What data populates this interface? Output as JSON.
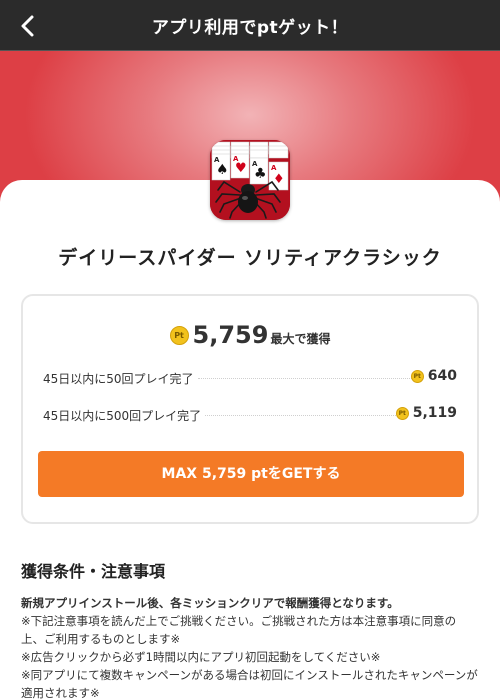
{
  "header": {
    "title": "アプリ利用でptゲット！",
    "back_icon": "chevron-left-icon"
  },
  "colors": {
    "header_bg": "#2b2b2b",
    "hero_red": "#dd3f45",
    "accent_orange": "#f47a26",
    "coin_gold": "#f2c21d"
  },
  "app": {
    "name": "デイリースパイダー ソリティアクラシック",
    "icon": "spider-solitaire-app-icon"
  },
  "reward": {
    "coin_text": "Pt",
    "total_value": "5,759",
    "total_label": "最大で獲得",
    "missions": [
      {
        "label": "45日以内に50回プレイ完了",
        "value": "640"
      },
      {
        "label": "45日以内に500回プレイ完了",
        "value": "5,119"
      }
    ],
    "cta_label": "MAX 5,759 ptをGETする"
  },
  "conditions": {
    "title": "獲得条件・注意事項",
    "lead": "新規アプリインストール後、各ミッションクリアで報酬獲得となります。",
    "notes": [
      "※下記注意事項を読んだ上でご挑戦ください。ご挑戦された方は本注意事項に同意の上、ご利用するものとします※",
      "※広告クリックから必ず1時間以内にアプリ初回起動をしてください※",
      "※同アプリにて複数キャンペーンがある場合は初回にインストールされたキャンペーンが適用されます※"
    ]
  }
}
